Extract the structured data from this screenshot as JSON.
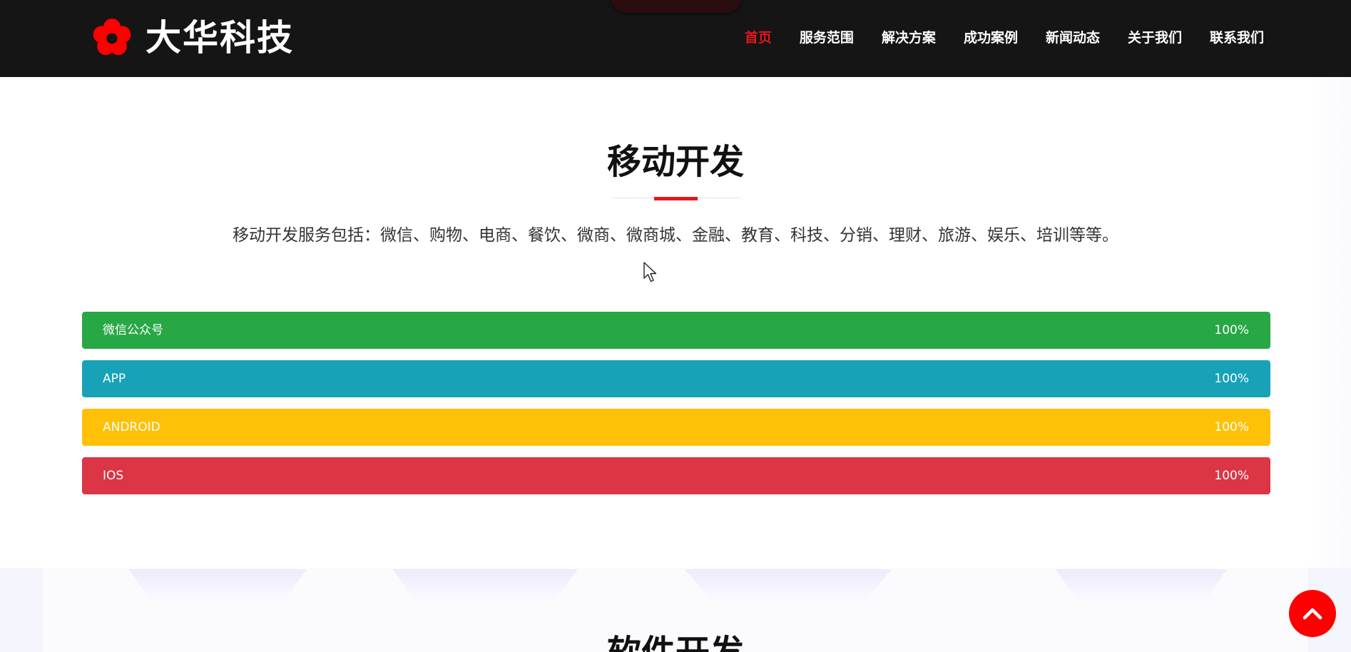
{
  "header": {
    "logo_text": "大华科技",
    "nav": [
      {
        "label": "首页",
        "active": true
      },
      {
        "label": "服务范围",
        "active": false
      },
      {
        "label": "解决方案",
        "active": false
      },
      {
        "label": "成功案例",
        "active": false
      },
      {
        "label": "新闻动态",
        "active": false
      },
      {
        "label": "关于我们",
        "active": false
      },
      {
        "label": "联系我们",
        "active": false
      }
    ]
  },
  "section": {
    "title": "移动开发",
    "description": "移动开发服务包括：微信、购物、电商、餐饮、微商、微商城、金融、教育、科技、分销、理财、旅游、娱乐、培训等等。",
    "bars": [
      {
        "label": "微信公众号",
        "value_text": "100%",
        "percent": 100,
        "color": "#28a745"
      },
      {
        "label": "APP",
        "value_text": "100%",
        "percent": 100,
        "color": "#17a2b8"
      },
      {
        "label": "ANDROID",
        "value_text": "100%",
        "percent": 100,
        "color": "#ffc107"
      },
      {
        "label": "IOS",
        "value_text": "100%",
        "percent": 100,
        "color": "#dc3545"
      }
    ]
  },
  "next_section": {
    "title": "软件开发"
  },
  "icons": {
    "logo": "plum-blossom-icon",
    "back_to_top": "chevron-up-icon",
    "cursor": "mouse-pointer-icon"
  },
  "colors": {
    "accent": "#e3171c",
    "header_bg": "#151515",
    "back_to_top_bg": "#ff0000"
  }
}
